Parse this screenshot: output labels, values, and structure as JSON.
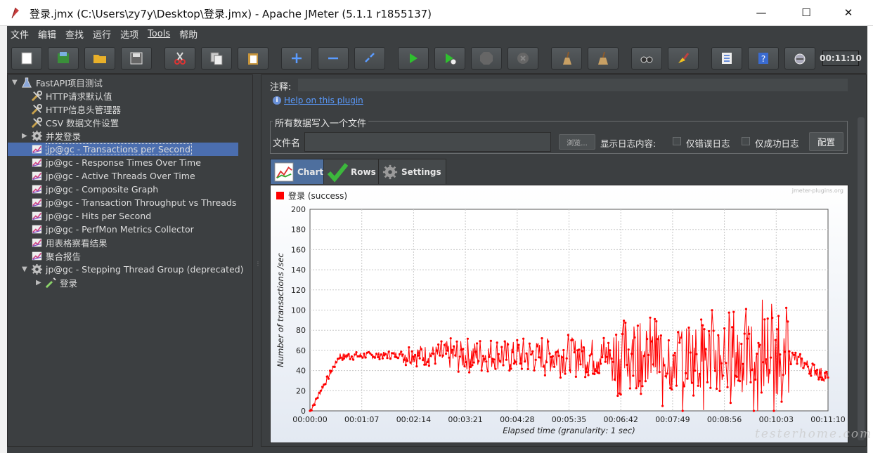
{
  "window": {
    "title": "登录.jmx (C:\\Users\\zy7y\\Desktop\\登录.jmx) - Apache JMeter (5.1.1 r1855137)",
    "minimize": "—",
    "maximize": "☐",
    "close": "✕"
  },
  "menu": [
    "文件",
    "编辑",
    "查找",
    "运行",
    "选项",
    "Tools",
    "帮助"
  ],
  "toolbar": {
    "timer": "00:11:10"
  },
  "tree": {
    "items": [
      {
        "label": "FastAPI项目测试",
        "icon": "flask-icon",
        "arrow": "▼",
        "indent": 0
      },
      {
        "label": "HTTP请求默认值",
        "icon": "wrench-icon",
        "arrow": "",
        "indent": 1
      },
      {
        "label": "HTTP信息头管理器",
        "icon": "wrench-icon",
        "arrow": "",
        "indent": 1
      },
      {
        "label": "CSV 数据文件设置",
        "icon": "wrench-icon",
        "arrow": "",
        "indent": 1
      },
      {
        "label": "并发登录",
        "icon": "gear-icon",
        "arrow": "▶",
        "indent": 1
      },
      {
        "label": "jp@gc - Transactions per Second",
        "icon": "graph-icon",
        "arrow": "",
        "indent": 1,
        "selected": true
      },
      {
        "label": "jp@gc - Response Times Over Time",
        "icon": "graph-icon",
        "arrow": "",
        "indent": 1
      },
      {
        "label": "jp@gc - Active Threads Over Time",
        "icon": "graph-icon",
        "arrow": "",
        "indent": 1
      },
      {
        "label": "jp@gc - Composite Graph",
        "icon": "graph-icon",
        "arrow": "",
        "indent": 1
      },
      {
        "label": "jp@gc - Transaction Throughput vs Threads",
        "icon": "graph-icon",
        "arrow": "",
        "indent": 1
      },
      {
        "label": "jp@gc - Hits per Second",
        "icon": "graph-icon",
        "arrow": "",
        "indent": 1
      },
      {
        "label": "jp@gc - PerfMon Metrics Collector",
        "icon": "graph-icon",
        "arrow": "",
        "indent": 1
      },
      {
        "label": "用表格察看结果",
        "icon": "graph-icon",
        "arrow": "",
        "indent": 1
      },
      {
        "label": "聚合报告",
        "icon": "graph-icon",
        "arrow": "",
        "indent": 1
      },
      {
        "label": "jp@gc - Stepping Thread Group (deprecated)",
        "icon": "gear-icon",
        "arrow": "▼",
        "indent": 1
      },
      {
        "label": "登录",
        "icon": "pipette-icon",
        "arrow": "▶",
        "indent": 2
      }
    ]
  },
  "panel": {
    "comment_label": "注释:",
    "help_link": "Help on this plugin",
    "file_group_title": "所有数据写入一个文件",
    "filename_label": "文件名",
    "browse_button": "浏览...",
    "log_label": "显示日志内容:",
    "errors_only": "仅错误日志",
    "success_only": "仅成功日志",
    "config_button": "配置",
    "tabs": [
      {
        "label": "Chart",
        "icon": "chart-icon",
        "active": true
      },
      {
        "label": "Rows",
        "icon": "checkmark-icon",
        "active": false
      },
      {
        "label": "Settings",
        "icon": "gear-icon",
        "active": false
      }
    ]
  },
  "chart_data": {
    "type": "line",
    "title": "",
    "brand": "jmeter-plugins.org",
    "legend": [
      {
        "name": "登录 (success)",
        "color": "#ff0000"
      }
    ],
    "legend_placement": "top-left",
    "xlabel": "Elapsed time (granularity: 1 sec)",
    "ylabel": "Number of transactions /sec",
    "ylim": [
      0,
      200
    ],
    "yticks": [
      "0",
      "20",
      "40",
      "60",
      "80",
      "100",
      "120",
      "140",
      "160",
      "180",
      "200"
    ],
    "xlim_seconds": [
      0,
      670
    ],
    "xticks": [
      "00:00:00",
      "00:01:07",
      "00:02:14",
      "00:03:21",
      "00:04:28",
      "00:05:35",
      "00:06:42",
      "00:07:49",
      "00:08:56",
      "00:10:03",
      "00:11:10"
    ],
    "grid": true,
    "series": [
      {
        "name": "登录 (success)",
        "color": "#ff0000",
        "segments": [
          {
            "from_s": 0,
            "to_s": 40,
            "start": 0,
            "end": 57,
            "noise": 3
          },
          {
            "from_s": 40,
            "to_s": 120,
            "start": 54,
            "end": 56,
            "noise": 4
          },
          {
            "from_s": 120,
            "to_s": 170,
            "start": 56,
            "end": 56,
            "noise": 12
          },
          {
            "from_s": 170,
            "to_s": 300,
            "start": 55,
            "end": 55,
            "noise": 18
          },
          {
            "from_s": 300,
            "to_s": 390,
            "start": 55,
            "end": 55,
            "noise": 22
          },
          {
            "from_s": 390,
            "to_s": 520,
            "start": 55,
            "end": 55,
            "noise": 40
          },
          {
            "from_s": 520,
            "to_s": 620,
            "start": 55,
            "end": 55,
            "noise": 48
          },
          {
            "from_s": 620,
            "to_s": 670,
            "start": 55,
            "end": 33,
            "noise": 8
          }
        ],
        "max_value": 126,
        "min_value": 0,
        "last_value": 33
      }
    ]
  },
  "watermark": "testerhome.com"
}
